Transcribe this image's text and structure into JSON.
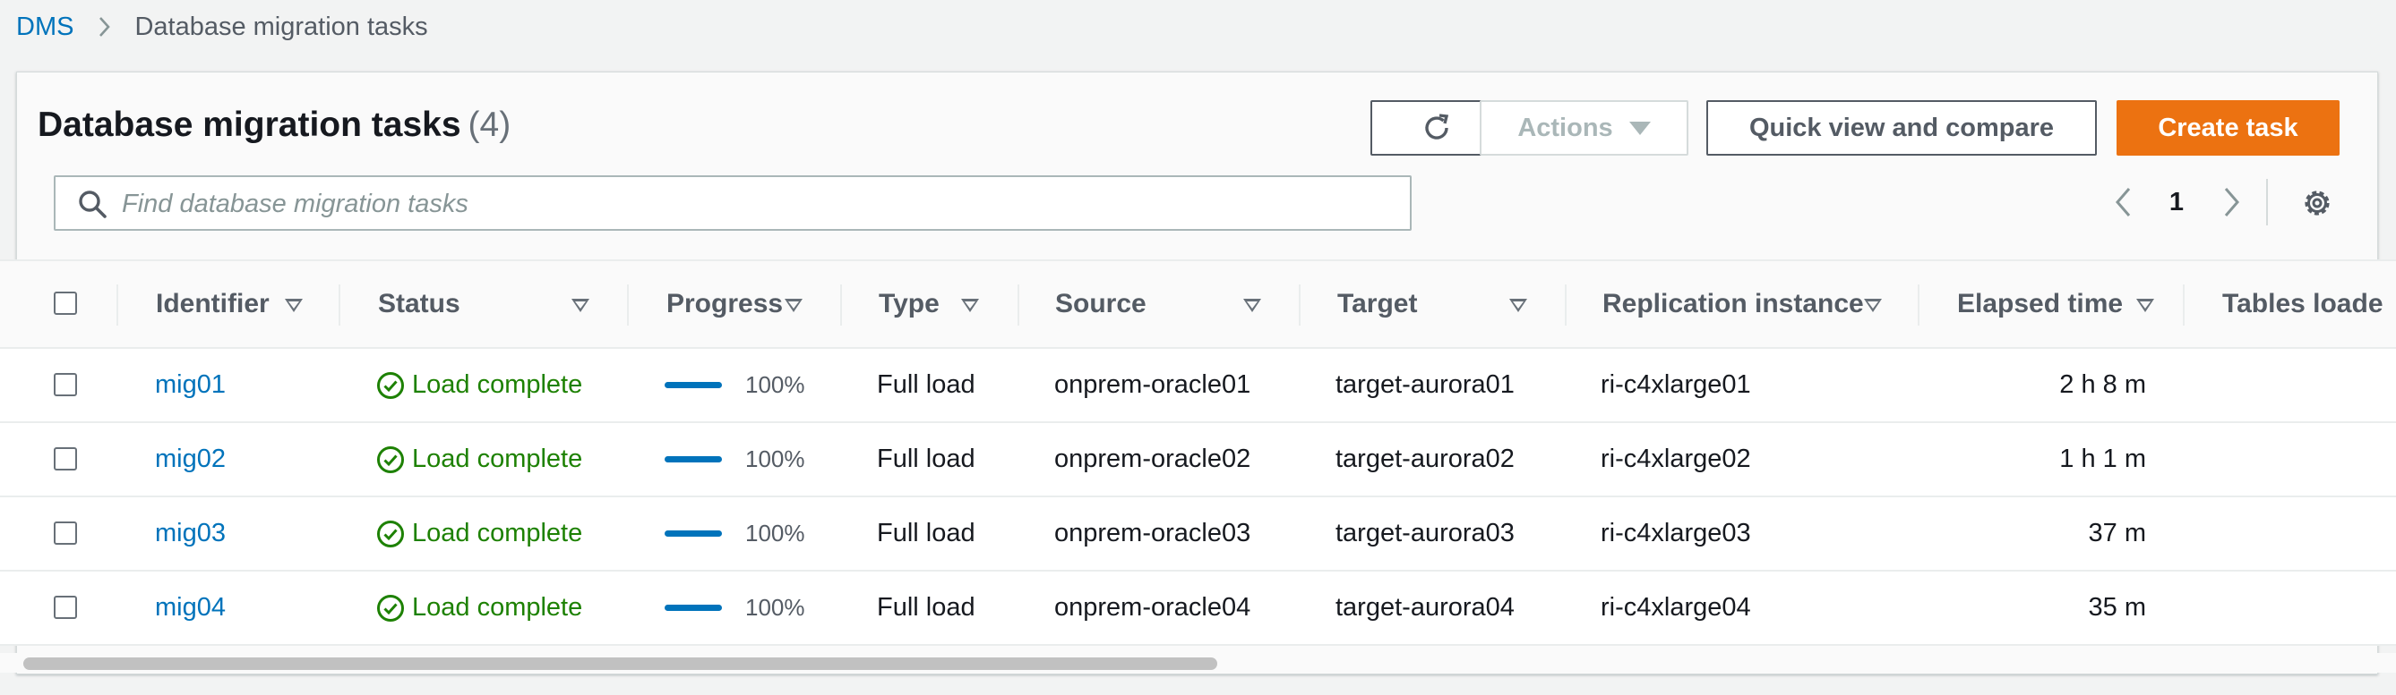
{
  "breadcrumb": {
    "root": "DMS",
    "current": "Database migration tasks"
  },
  "panel": {
    "title": "Database migration tasks",
    "count": "(4)"
  },
  "toolbar": {
    "refresh_icon": "refresh-icon",
    "actions_label": "Actions",
    "quick_view_label": "Quick view and compare",
    "create_label": "Create task"
  },
  "search": {
    "placeholder": "Find database migration tasks"
  },
  "pagination": {
    "page": "1"
  },
  "columns": {
    "identifier": "Identifier",
    "status": "Status",
    "progress": "Progress",
    "type": "Type",
    "source": "Source",
    "target": "Target",
    "replication_instance": "Replication instance",
    "elapsed_time": "Elapsed time",
    "tables_loaded": "Tables loade"
  },
  "rows": [
    {
      "identifier": "mig01",
      "status": "Load complete",
      "progress": 1.0,
      "progress_label": "100%",
      "type": "Full load",
      "source": "onprem-oracle01",
      "target": "target-aurora01",
      "replication_instance": "ri-c4xlarge01",
      "elapsed_time": "2 h 8 m"
    },
    {
      "identifier": "mig02",
      "status": "Load complete",
      "progress": 1.0,
      "progress_label": "100%",
      "type": "Full load",
      "source": "onprem-oracle02",
      "target": "target-aurora02",
      "replication_instance": "ri-c4xlarge02",
      "elapsed_time": "1 h 1 m"
    },
    {
      "identifier": "mig03",
      "status": "Load complete",
      "progress": 1.0,
      "progress_label": "100%",
      "type": "Full load",
      "source": "onprem-oracle03",
      "target": "target-aurora03",
      "replication_instance": "ri-c4xlarge03",
      "elapsed_time": "37 m"
    },
    {
      "identifier": "mig04",
      "status": "Load complete",
      "progress": 1.0,
      "progress_label": "100%",
      "type": "Full load",
      "source": "onprem-oracle04",
      "target": "target-aurora04",
      "replication_instance": "ri-c4xlarge04",
      "elapsed_time": "35 m"
    }
  ],
  "colors": {
    "accent": "#0073bb",
    "primary_button": "#ec7211",
    "success": "#1d8102",
    "background": "#f2f3f3"
  }
}
